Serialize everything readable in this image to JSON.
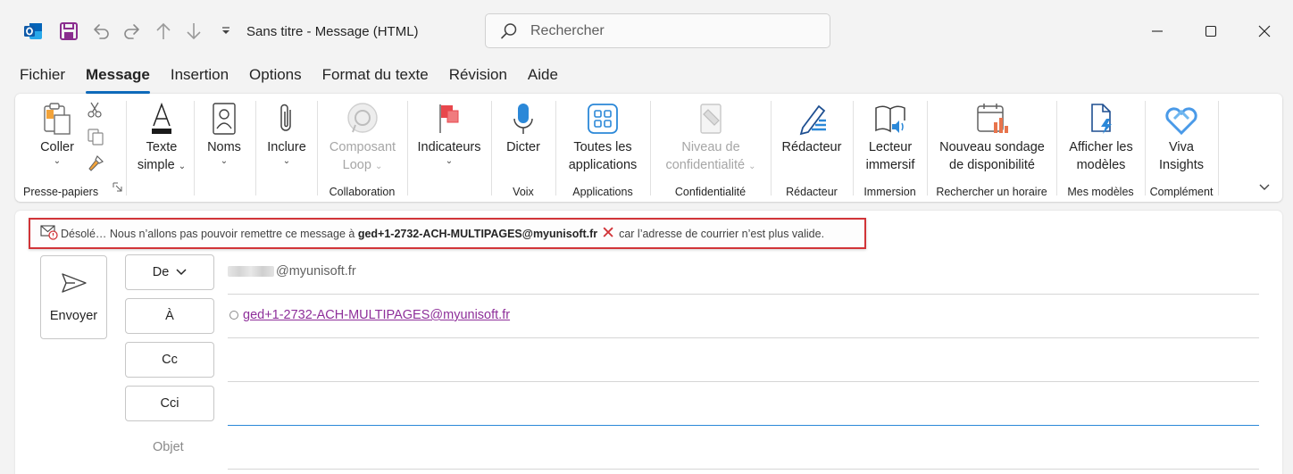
{
  "window": {
    "title": "Sans titre  -  Message (HTML)",
    "search_placeholder": "Rechercher"
  },
  "tabs": [
    "Fichier",
    "Message",
    "Insertion",
    "Options",
    "Format du texte",
    "Révision",
    "Aide"
  ],
  "active_tab": "Message",
  "ribbon": {
    "paste": {
      "label": "Coller",
      "group": "Presse-papiers"
    },
    "text": {
      "line1": "Texte",
      "line2": "simple"
    },
    "names": {
      "label": "Noms"
    },
    "include": {
      "label": "Inclure"
    },
    "loop": {
      "line1": "Composant",
      "line2": "Loop",
      "group": "Collaboration"
    },
    "flags": {
      "label": "Indicateurs"
    },
    "dictate": {
      "label": "Dicter",
      "group": "Voix"
    },
    "apps": {
      "line1": "Toutes les",
      "line2": "applications",
      "group": "Applications"
    },
    "sensitivity": {
      "line1": "Niveau de",
      "line2": "confidentialité",
      "group": "Confidentialité"
    },
    "editor": {
      "label": "Rédacteur",
      "group": "Rédacteur"
    },
    "reader": {
      "line1": "Lecteur",
      "line2": "immersif",
      "group": "Immersion"
    },
    "poll": {
      "line1": "Nouveau sondage",
      "line2": "de disponibilité",
      "group": "Rechercher un horaire"
    },
    "templates": {
      "line1": "Afficher les",
      "line2": "modèles",
      "group": "Mes modèles"
    },
    "viva": {
      "line1": "Viva",
      "line2": "Insights",
      "group": "Complément"
    }
  },
  "infobar": {
    "prefix": "Désolé… Nous n’allons pas pouvoir remettre ce message à",
    "address": "ged+1-2732-ACH-MULTIPAGES@myunisoft.fr",
    "suffix": "car l’adresse de courrier n’est plus valide."
  },
  "compose": {
    "send_label": "Envoyer",
    "from_label": "De",
    "from_domain": "@myunisoft.fr",
    "to_label": "À",
    "to_address": "ged+1-2732-ACH-MULTIPAGES@myunisoft.fr",
    "cc_label": "Cc",
    "bcc_label": "Cci",
    "subject_label": "Objet"
  }
}
